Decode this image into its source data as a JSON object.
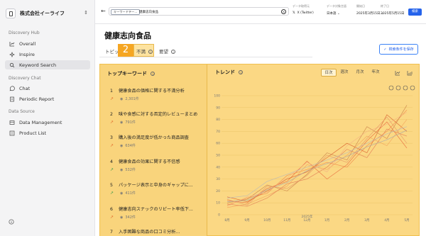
{
  "sidebar": {
    "company": "株式会社イーライフ",
    "sections": [
      {
        "label": "Discovery Hub",
        "items": [
          {
            "label": "Overall",
            "icon": "chart-icon"
          },
          {
            "label": "Inspire",
            "icon": "sparkle-icon"
          },
          {
            "label": "Keyword Search",
            "icon": "search-icon",
            "active": true
          }
        ]
      },
      {
        "label": "Discovery Chat",
        "items": [
          {
            "label": "Chat",
            "icon": "chat-icon"
          },
          {
            "label": "Periodic Report",
            "icon": "report-icon"
          }
        ]
      },
      {
        "label": "Data Source",
        "items": [
          {
            "label": "Data Management",
            "icon": "database-icon"
          },
          {
            "label": "Product List",
            "icon": "list-icon"
          }
        ]
      }
    ]
  },
  "topbar": {
    "chip": "キーワードテー...",
    "keyword": "健康志向食品",
    "source_label": "データ取得元",
    "source_value": "X (Twitter)",
    "lang_label": "データ対象言語",
    "lang_value": "日本語",
    "start_label": "開始日",
    "start_value": "2025年3月15日",
    "end_label": "終了日",
    "end_value": "2025年5月15日",
    "search_button": "検索"
  },
  "main": {
    "title": "健康志向食品",
    "tabs": [
      "トピック",
      "不満",
      "要望"
    ],
    "badge": "2",
    "save_conditions": "検索条件を保存"
  },
  "top_keywords": {
    "title": "トップキーワード",
    "items": [
      {
        "rank": "1",
        "text": "健康食品の価格に関する不満分析",
        "count": "2,301件",
        "trend": "up-orange"
      },
      {
        "rank": "2",
        "text": "味や食感に対する否定的レビューまとめ",
        "count": "791件",
        "trend": "up-orange"
      },
      {
        "rank": "3",
        "text": "購入後の満足度が低かった商品調査",
        "count": "634件",
        "trend": "up-orange"
      },
      {
        "rank": "4",
        "text": "健康食品の効果に関する不信感",
        "count": "532件",
        "trend": "up-green"
      },
      {
        "rank": "5",
        "text": "パッケージ表示と中身のギャップに...",
        "count": "411件",
        "trend": "up-green"
      },
      {
        "rank": "6",
        "text": "健康志向スナックのリピート率低下...",
        "count": "342件",
        "trend": "up-orange"
      },
      {
        "rank": "7",
        "text": "入手困難な商品の口コミ分析..."
      }
    ]
  },
  "trend": {
    "title": "トレンド",
    "ranges": [
      "日次",
      "週次",
      "月次",
      "年次"
    ]
  },
  "chart_data": {
    "type": "line",
    "x": [
      "8月",
      "9月",
      "10月",
      "11月",
      "12月",
      "1月",
      "2月",
      "3月",
      "4月",
      "5月"
    ],
    "x_sublabel": "2025年",
    "ylim": [
      0,
      100
    ],
    "yticks": [
      0,
      10,
      20,
      30,
      40,
      50,
      60,
      70,
      80,
      90,
      100
    ],
    "series": [
      {
        "color": "#e8653a",
        "values": [
          12,
          10,
          22,
          28,
          45,
          30,
          42,
          62,
          78,
          56
        ]
      },
      {
        "color": "#f08a4b",
        "values": [
          8,
          14,
          18,
          33,
          38,
          44,
          40,
          58,
          70,
          88
        ]
      },
      {
        "color": "#d85a2a",
        "values": [
          15,
          11,
          20,
          30,
          36,
          48,
          60,
          52,
          84,
          70
        ]
      },
      {
        "color": "#f2a35c",
        "values": [
          6,
          9,
          16,
          24,
          42,
          38,
          50,
          66,
          58,
          80
        ]
      },
      {
        "color": "#c9804a",
        "values": [
          10,
          13,
          25,
          20,
          34,
          52,
          46,
          74,
          64,
          92
        ]
      },
      {
        "color": "#e07b55",
        "values": [
          9,
          7,
          14,
          26,
          30,
          40,
          55,
          48,
          72,
          66
        ]
      },
      {
        "color": "#b8b8b8",
        "values": [
          14,
          16,
          28,
          34,
          40,
          46,
          52,
          60,
          68,
          74
        ]
      },
      {
        "color": "#a8a8a8",
        "values": [
          11,
          12,
          21,
          27,
          37,
          43,
          49,
          57,
          63,
          71
        ]
      },
      {
        "color": "#f4b183",
        "values": [
          7,
          15,
          19,
          31,
          44,
          36,
          58,
          70,
          76,
          86
        ]
      },
      {
        "color": "#e59866",
        "values": [
          13,
          8,
          24,
          22,
          33,
          50,
          44,
          64,
          82,
          60
        ]
      }
    ]
  }
}
